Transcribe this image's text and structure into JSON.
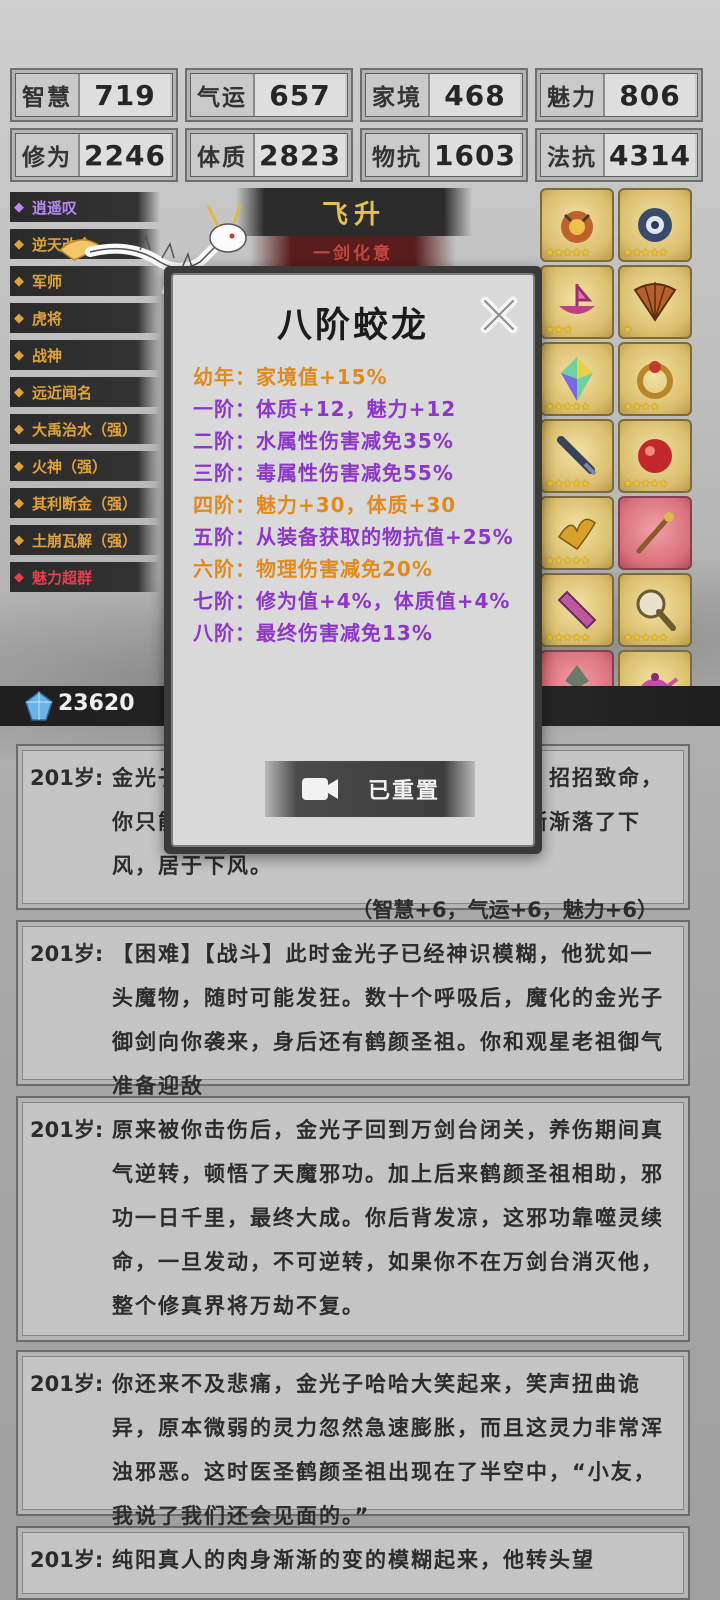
{
  "stats": [
    {
      "label": "智慧",
      "value": "719"
    },
    {
      "label": "气运",
      "value": "657"
    },
    {
      "label": "家境",
      "value": "468"
    },
    {
      "label": "魅力",
      "value": "806"
    },
    {
      "label": "修为",
      "value": "2246"
    },
    {
      "label": "体质",
      "value": "2823"
    },
    {
      "label": "物抗",
      "value": "1603"
    },
    {
      "label": "法抗",
      "value": "4314"
    }
  ],
  "tags": [
    {
      "label": "逍遥叹",
      "color": "#b889f0"
    },
    {
      "label": "逆天改命",
      "color": "#e0a23a"
    },
    {
      "label": "军师",
      "color": "#e0a23a"
    },
    {
      "label": "虎将",
      "color": "#e0a23a"
    },
    {
      "label": "战神",
      "color": "#e0a23a"
    },
    {
      "label": "远近闻名",
      "color": "#e0a23a"
    },
    {
      "label": "大禹治水（强）",
      "color": "#e0a23a"
    },
    {
      "label": "火神（强）",
      "color": "#e0a23a"
    },
    {
      "label": "其利断金（强）",
      "color": "#e0a23a"
    },
    {
      "label": "土崩瓦解（强）",
      "color": "#e0a23a"
    },
    {
      "label": "魅力超群",
      "color": "#e2404a"
    }
  ],
  "banner": {
    "title": "飞升",
    "subtitle": "一剑化意"
  },
  "equipment": [
    {
      "name": "orb-relic-icon",
      "stars": "★★★★★",
      "rarity": "gold"
    },
    {
      "name": "spirit-beast-icon",
      "stars": "★★★★★",
      "rarity": "gold"
    },
    {
      "name": "pink-boat-icon",
      "stars": "★★★",
      "rarity": "gold"
    },
    {
      "name": "fan-icon",
      "stars": "★",
      "rarity": "gold"
    },
    {
      "name": "rainbow-crystal-icon",
      "stars": "★★★★★",
      "rarity": "gold"
    },
    {
      "name": "gold-ring-icon",
      "stars": "★★★★",
      "rarity": "gold"
    },
    {
      "name": "dark-sword-icon",
      "stars": "★★★★★",
      "rarity": "gold"
    },
    {
      "name": "red-orb-icon",
      "stars": "★★★★★",
      "rarity": "gold"
    },
    {
      "name": "golden-bird-icon",
      "stars": "★★★★★",
      "rarity": "gold"
    },
    {
      "name": "staff-icon",
      "stars": "",
      "rarity": "red"
    },
    {
      "name": "pink-scroll-icon",
      "stars": "★★★★★",
      "rarity": "gold"
    },
    {
      "name": "mirror-icon",
      "stars": "★★★★★",
      "rarity": "gold"
    },
    {
      "name": "spade-icon",
      "stars": "★★★★★",
      "rarity": "red"
    },
    {
      "name": "teapot-icon",
      "stars": "★",
      "rarity": "gold"
    }
  ],
  "currency": {
    "value": "23620"
  },
  "modal": {
    "title": "八阶蛟龙",
    "tiers": [
      {
        "text": "幼年：家境值+15%",
        "color": "orange"
      },
      {
        "text": "一阶：体质+12，魅力+12",
        "color": "purple"
      },
      {
        "text": "二阶：水属性伤害减免35%",
        "color": "purple"
      },
      {
        "text": "三阶：毒属性伤害减免55%",
        "color": "purple"
      },
      {
        "text": "四阶：魅力+30，体质+30",
        "color": "orange"
      },
      {
        "text": "五阶：从装备获取的物抗值+25%",
        "color": "purple"
      },
      {
        "text": "六阶：物理伤害减免20%",
        "color": "orange"
      },
      {
        "text": "七阶：修为值+4%，体质值+4%",
        "color": "purple"
      },
      {
        "text": "八阶：最终伤害减免13%",
        "color": "purple"
      }
    ],
    "reset_label": "已重置"
  },
  "logs": [
    {
      "age": "201岁:",
      "text": "金光子原来越有利，有了鹤颜圣祖的辅助，招招致命，你只能勉强支撑，与其周旋的游刃有余，渐渐落了下风，居于下风。",
      "bonus": "（智慧+6，气运+6，魅力+6）"
    },
    {
      "age": "201岁:",
      "text": "【困难】【战斗】此时金光子已经神识模糊，他犹如一头魔物，随时可能发狂。数十个呼吸后，魔化的金光子御剑向你袭来，身后还有鹤颜圣祖。你和观星老祖御气准备迎敌",
      "bonus": ""
    },
    {
      "age": "201岁:",
      "text": "原来被你击伤后，金光子回到万剑台闭关，养伤期间真气逆转，顿悟了天魔邪功。加上后来鹤颜圣祖相助，邪功一日千里，最终大成。你后背发凉，这邪功靠噬灵续命，一旦发动，不可逆转，如果你不在万剑台消灭他，整个修真界将万劫不复。",
      "bonus": ""
    },
    {
      "age": "201岁:",
      "text": "你还来不及悲痛，金光子哈哈大笑起来，笑声扭曲诡异，原本微弱的灵力忽然急速膨胀，而且这灵力非常浑浊邪恶。这时医圣鹤颜圣祖出现在了半空中，“小友，我说了我们还会见面的。”",
      "bonus": ""
    },
    {
      "age": "201岁:",
      "text": "纯阳真人的肉身渐渐的变的模糊起来，他转头望",
      "bonus": ""
    }
  ]
}
